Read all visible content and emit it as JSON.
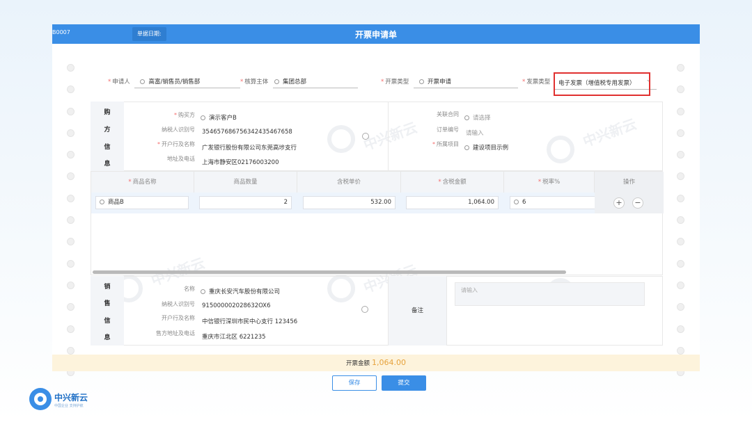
{
  "header": {
    "doc_no": "B0007",
    "date_label": "单据日期:",
    "title": "开票申请单"
  },
  "top_fields": {
    "applicant": {
      "label": "申请人",
      "value": "高富/销售员/销售部"
    },
    "entity": {
      "label": "核算主体",
      "value": "集团总部"
    },
    "invoice_kind": {
      "label": "开票类型",
      "value": "开票申请"
    },
    "invoice_type": {
      "label": "发票类型",
      "value": "电子发票（增值税专用发票）"
    }
  },
  "buyer": {
    "side_chars": [
      "购",
      "方",
      "信",
      "息"
    ],
    "left": [
      {
        "label": "购买方",
        "value": "演示客户B"
      },
      {
        "label": "纳税人识别号",
        "value": "354657686756342435467658"
      },
      {
        "label": "开户行及名称",
        "value": "广发银行股份有限公司东莞高埗支行"
      },
      {
        "label": "地址及电话",
        "value": "上海市静安区02176003200"
      }
    ],
    "right": [
      {
        "label": "关联合同",
        "value": "请选择"
      },
      {
        "label": "订单编号",
        "value": "请输入"
      },
      {
        "label": "所属项目",
        "value": "建设项目示例"
      }
    ]
  },
  "items_table": {
    "headers": [
      "商品名称",
      "商品数量",
      "含税单价",
      "含税金额",
      "税率%",
      "操作"
    ],
    "rows": [
      {
        "name": "商品B",
        "qty": "2",
        "price": "532.00",
        "amount": "1,064.00",
        "rate": "6"
      }
    ]
  },
  "seller": {
    "side_chars": [
      "销",
      "售",
      "信",
      "息"
    ],
    "left": [
      {
        "label": "名称",
        "value": "重庆长安汽车股份有限公司"
      },
      {
        "label": "纳税人识别号",
        "value": "915000002028632OX6"
      },
      {
        "label": "开户行及名称",
        "value": "中信银行深圳市民中心支行  123456"
      },
      {
        "label": "售方地址及电话",
        "value": "重庆市江北区  6221235"
      }
    ],
    "remark_label": "备注",
    "remark_placeholder": "请输入"
  },
  "total": {
    "label": "开票金额",
    "value": "1,064.00"
  },
  "actions": {
    "save": "保存",
    "submit": "提交"
  },
  "brand": {
    "name": "中兴新云",
    "tagline": "中国企业  支持护航"
  },
  "colors": {
    "header_blue": "#3a8ee6",
    "highlight": "#e0302f",
    "amount": "#e6a23c"
  }
}
